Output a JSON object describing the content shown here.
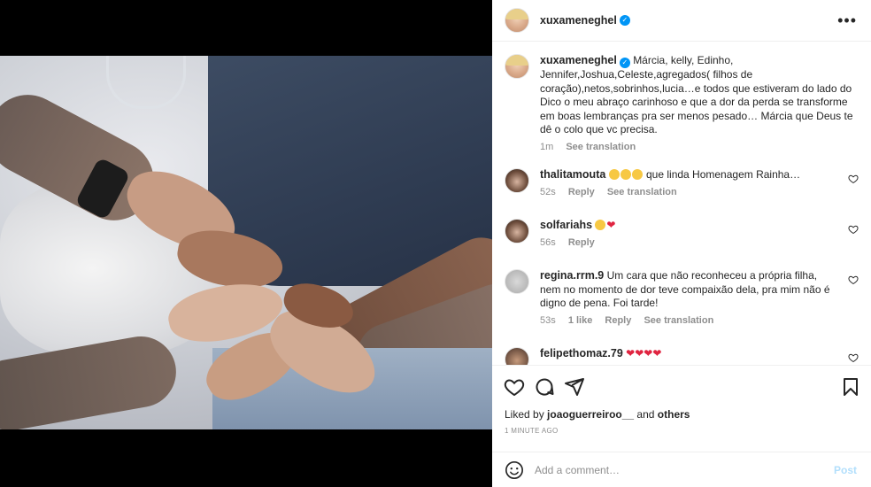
{
  "post": {
    "username": "xuxameneghel",
    "verified_mark": "✓",
    "more_glyph": "•••"
  },
  "caption": {
    "username": "xuxameneghel",
    "text": "Márcia, kelly, Edinho, Jennifer,Joshua,Celeste,agregados( filhos de coração),netos,sobrinhos,lucia…e todos que estiveram do lado do Dico o meu abraço carinhoso e que a dor da perda se transforme em boas lembranças pra ser menos pesado… Márcia que Deus te dê o colo que vc precisa.",
    "age": "1m",
    "see_translation": "See translation"
  },
  "comments": [
    {
      "username": "thalitamouta",
      "emoji": [
        "raised-hands",
        "clap",
        "clap"
      ],
      "text": "que linda Homenagem Rainha…",
      "age": "52s",
      "reply": "Reply",
      "see_translation": "See translation"
    },
    {
      "username": "solfariahs",
      "emoji": [
        "sad-face",
        "red-heart"
      ],
      "text": "",
      "age": "56s",
      "reply": "Reply"
    },
    {
      "username": "regina.rrm.9",
      "text": "Um cara que não reconheceu a própria filha, nem no momento de dor teve compaixão dela, pra mim não é digno de pena. Foi tarde!",
      "age": "53s",
      "likes": "1 like",
      "reply": "Reply",
      "see_translation": "See translation"
    },
    {
      "username": "felipethomaz.79",
      "emoji": [
        "red-heart",
        "red-heart",
        "red-heart",
        "red-heart"
      ],
      "text": ""
    }
  ],
  "liked_by": {
    "prefix": "Liked by",
    "user": "joaoguerreiroo__",
    "and": "and",
    "others": "others"
  },
  "timestamp": "1 MINUTE AGO",
  "add_comment": {
    "placeholder": "Add a comment…",
    "post_label": "Post"
  },
  "colors": {
    "verified": "#0095f6",
    "muted": "#8e8e8e",
    "post_disabled": "#b2dffc",
    "heart": "#e02440"
  }
}
